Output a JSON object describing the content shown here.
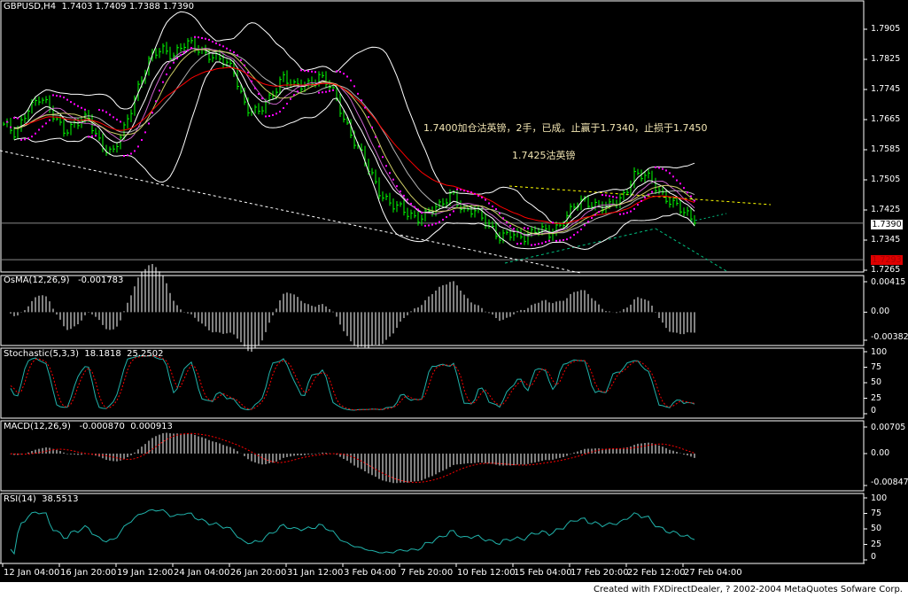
{
  "header": {
    "symbol": "GBPUSD,H4",
    "open": "1.7403",
    "high": "1.7409",
    "low": "1.7388",
    "close": "1.7390"
  },
  "annotations": [
    "1.7400加仓沽英镑，2手，已成。止赢于1.7340，止损于1.7450",
    "1.7425沽英镑"
  ],
  "price_axis": {
    "ticks": [
      "1.7905",
      "1.7825",
      "1.7745",
      "1.7665",
      "1.7585",
      "1.7505",
      "1.7425",
      "1.7345",
      "1.7265"
    ],
    "current_price": "1.7390",
    "line_price": "1.7293"
  },
  "colors": {
    "background": "#000000",
    "bars": "#00ff00",
    "bands": "#ffffff",
    "ma_slow": "#ff0000",
    "sar": "#ff00ff",
    "signal": "#ff0000",
    "stoch_main": "#20b2aa",
    "rsi": "#20b2aa",
    "price_box_line": "#ff0000",
    "yellow_trend": "#ffff00",
    "green_trend": "#00c080"
  },
  "panels": {
    "osma": {
      "title": "OsMA(12,26,9)",
      "value": "-0.001783",
      "ticks": [
        "0.00415",
        "0.00",
        "-0.00382"
      ],
      "range": [
        -0.00382,
        0.00415
      ]
    },
    "stoch": {
      "title": "Stochastic(5,3,3)",
      "main": "18.1818",
      "signal": "25.2502",
      "ticks": [
        "100",
        "75",
        "50",
        "25",
        "0"
      ],
      "range": [
        0,
        100
      ]
    },
    "macd": {
      "title": "MACD(12,26,9)",
      "main": "-0.000870",
      "signal": "0.000913",
      "ticks": [
        "0.00705",
        "0.00",
        "-0.00847"
      ],
      "range": [
        -0.00847,
        0.00705
      ]
    },
    "rsi": {
      "title": "RSI(14)",
      "value": "38.5513",
      "ticks": [
        "100",
        "75",
        "50",
        "25",
        "0"
      ],
      "range": [
        0,
        100
      ]
    }
  },
  "date_axis": [
    "12 Jan 04:00",
    "16 Jan 20:00",
    "19 Jan 12:00",
    "24 Jan 04:00",
    "26 Jan 20:00",
    "31 Jan 12:00",
    "3 Feb 04:00",
    "7 Feb 20:00",
    "10 Feb 12:00",
    "15 Feb 04:00",
    "17 Feb 20:00",
    "22 Feb 12:00",
    "27 Feb 04:00"
  ],
  "footer": "Created with FXDirectDealer, ? 2002-2004 MetaQuotes Sofware Corp.",
  "chart_data": {
    "type": "line",
    "title": "GBPUSD,H4",
    "ylim": [
      1.7265,
      1.7905
    ],
    "x": [
      "12 Jan 04:00",
      "16 Jan 20:00",
      "19 Jan 12:00",
      "24 Jan 04:00",
      "26 Jan 20:00",
      "31 Jan 12:00",
      "3 Feb 04:00",
      "7 Feb 20:00",
      "10 Feb 12:00",
      "15 Feb 04:00",
      "17 Feb 20:00",
      "22 Feb 12:00",
      "27 Feb 04:00"
    ],
    "approx_close": [
      1.7653,
      1.7618,
      1.77,
      1.7724,
      1.7677,
      1.7641,
      1.7653,
      1.7665,
      1.7606,
      1.7571,
      1.7641,
      1.7747,
      1.7818,
      1.7853,
      1.7841,
      1.7865,
      1.7853,
      1.7841,
      1.7818,
      1.7794,
      1.77,
      1.7677,
      1.7724,
      1.7783,
      1.7747,
      1.7759,
      1.7783,
      1.7747,
      1.7677,
      1.7606,
      1.7536,
      1.7477,
      1.7441,
      1.7418,
      1.7406,
      1.7418,
      1.743,
      1.7477,
      1.7418,
      1.7418,
      1.7394,
      1.7347,
      1.7359,
      1.7359,
      1.7371,
      1.7359,
      1.7394,
      1.743,
      1.7446,
      1.7441,
      1.743,
      1.7453,
      1.7524,
      1.7512,
      1.7477,
      1.7453,
      1.7418,
      1.739
    ],
    "indicators": [
      "Bollinger Bands",
      "Moving Averages",
      "Parabolic SAR",
      "OsMA(12,26,9)",
      "Stochastic(5,3,3)",
      "MACD(12,26,9)",
      "RSI(14)"
    ]
  }
}
